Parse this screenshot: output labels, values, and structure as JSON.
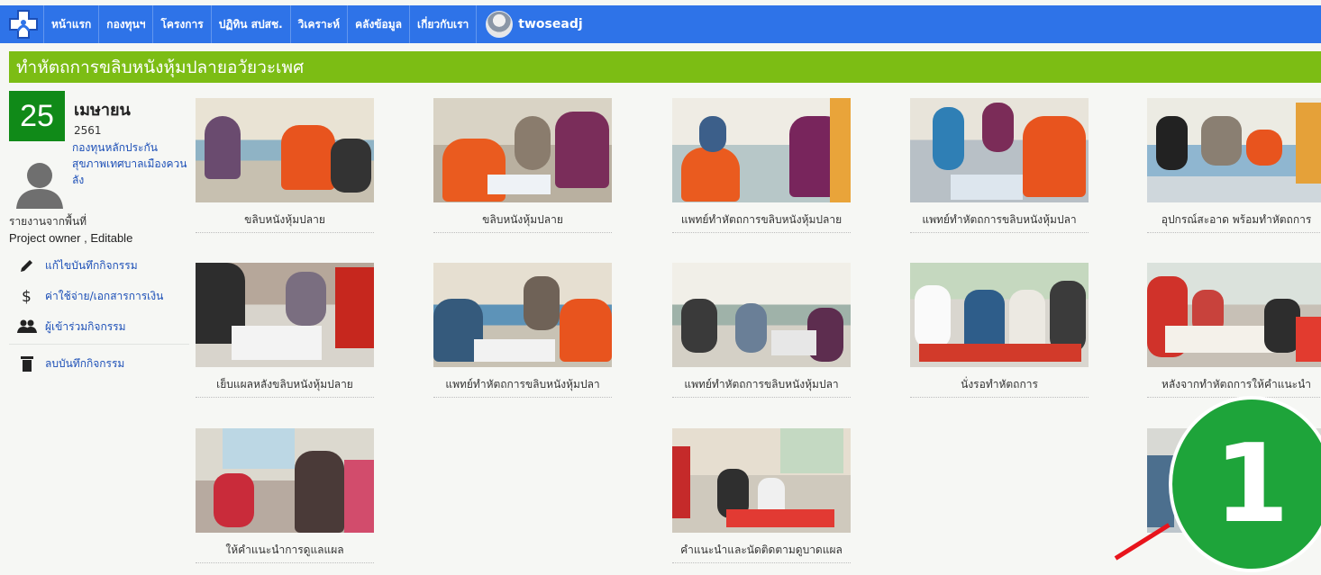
{
  "nav": {
    "items": [
      "หน้าแรก",
      "กองทุนฯ",
      "โครงการ",
      "ปฏิทิน สปสช.",
      "วิเคราะห์",
      "คลังข้อมูล",
      "เกี่ยวกับเรา"
    ],
    "username": "twoseadj",
    "logo_icon": "hospital-cross-icon"
  },
  "title": "ทำหัตถการขลิบหนังหุ้มปลายอวัยวะเพศ",
  "sidebar": {
    "day": "25",
    "month": "เมษายน",
    "year": "2561",
    "org": "กองทุนหลักประกันสุขภาพเทศบาลเมืองควนลัง",
    "report_label": "รายงานจากพื้นที่",
    "owner_label": "Project owner , Editable",
    "menu": [
      {
        "label": "แก้ไขบันทึกกิจกรรม",
        "icon": "pencil-icon"
      },
      {
        "label": "ค่าใช้จ่าย/เอกสารการเงิน",
        "icon": "dollar-icon"
      },
      {
        "label": "ผู้เข้าร่วมกิจกรรม",
        "icon": "people-icon"
      },
      {
        "label": "ลบบันทึกกิจกรรม",
        "icon": "trash-icon"
      }
    ]
  },
  "photos": [
    {
      "caption": "ขลิบหนังหุ้มปลาย"
    },
    {
      "caption": "ขลิบหนังหุ้มปลาย"
    },
    {
      "caption": "แพทย์ทำหัตถการขลิบหนังหุ้มปลาย"
    },
    {
      "caption": "แพทย์ทำหัตถการขลิบหนังหุ้มปลา"
    },
    {
      "caption": "อุปกรณ์สะอาด พร้อมทำหัตถการ"
    },
    {
      "caption": "เย็บแผลหลังขลิบหนังหุ้มปลาย"
    },
    {
      "caption": "แพทย์ทำหัตถการขลิบหนังหุ้มปลา"
    },
    {
      "caption": "แพทย์ทำหัตถการขลิบหนังหุ้มปลา"
    },
    {
      "caption": "นั่งรอทำหัตถการ"
    },
    {
      "caption": "หลังจากทำหัตถการให้คำแนะนำ"
    },
    {
      "caption": "ให้คำแนะนำการดูแลแผล"
    },
    {
      "caption": "คำแนะนำและนัดติดตามดูบาดแผล"
    },
    {
      "caption": ""
    }
  ],
  "overlay": {
    "badge_number": "1"
  },
  "colors": {
    "nav": "#2e73e8",
    "title": "#7cbd14",
    "date": "#108a18",
    "badge": "#1ea43a",
    "arrow": "#e8141c"
  }
}
